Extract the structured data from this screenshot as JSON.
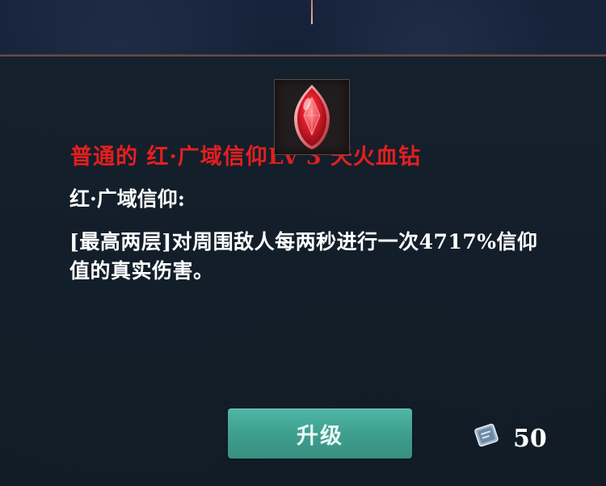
{
  "item": {
    "title": "普通的 红·广域信仰Lv 3 天火血钻",
    "icon": "red-gem-icon",
    "title_color": "#e41f1f"
  },
  "effect": {
    "name": "红·广域信仰:",
    "description": "[最高两层]对周围敌人每两秒进行一次4717%信仰值的真实伤害。"
  },
  "actions": {
    "upgrade_label": "升级",
    "upgrade_color": "#45a898"
  },
  "cost": {
    "icon": "book-token-icon",
    "value": "50"
  }
}
